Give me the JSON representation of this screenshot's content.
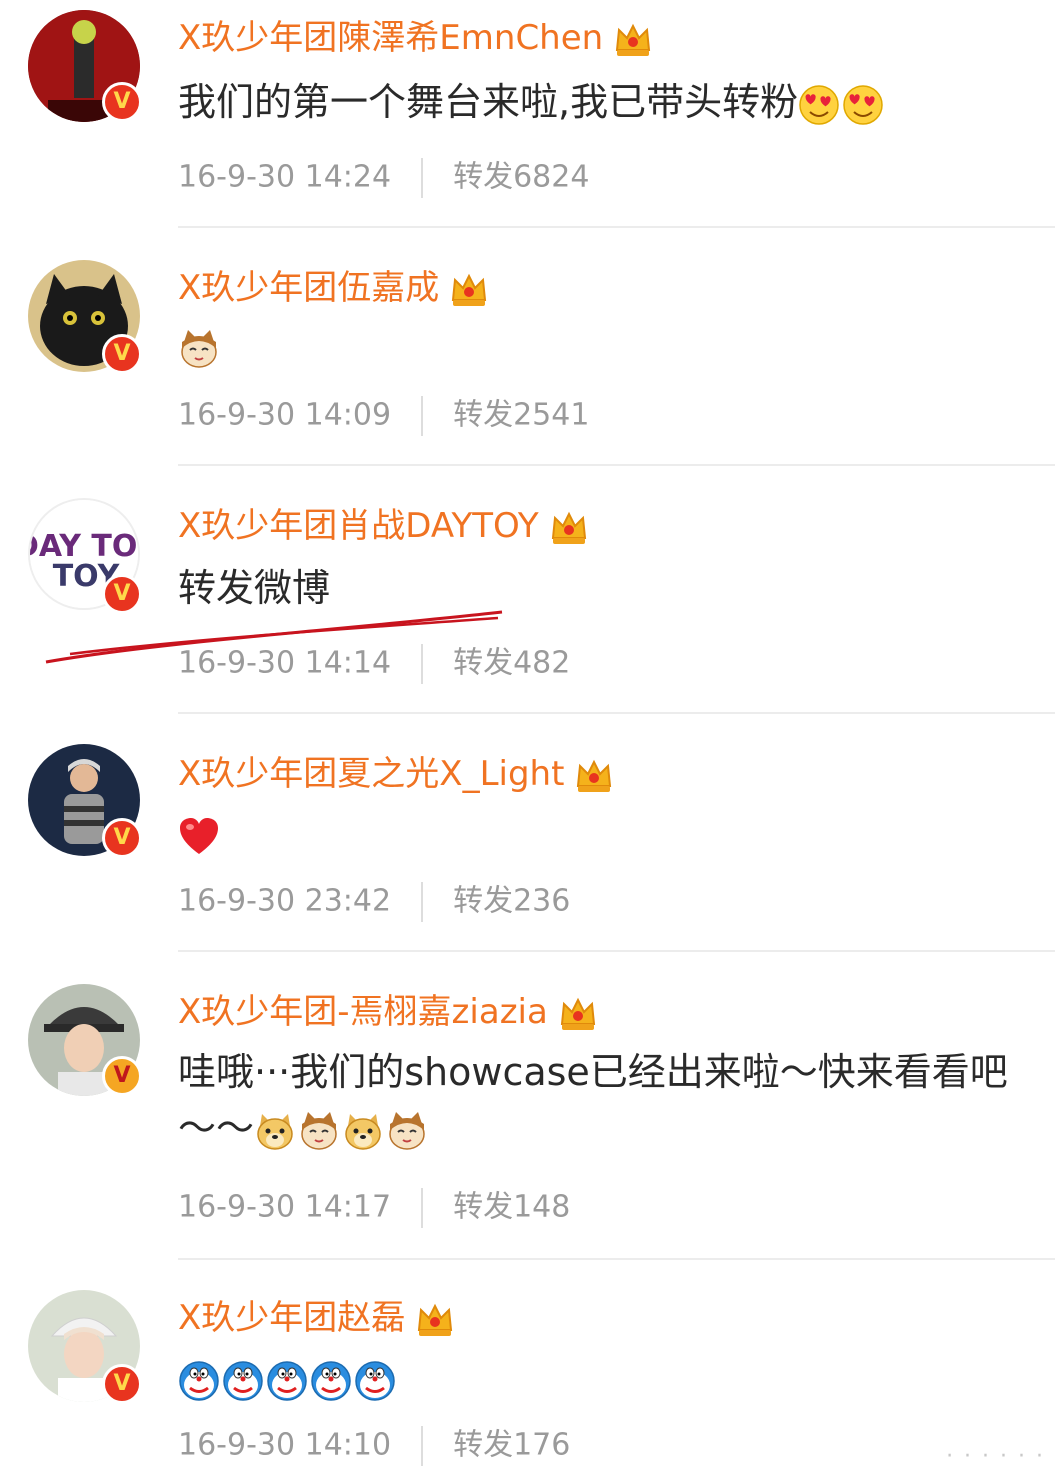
{
  "comments": [
    {
      "name": "X玖少年团陳澤希EmnChen",
      "text": "我们的第一个舞台来啦,我已带头转粉",
      "date": "16-9-30 14:24",
      "repost": "转发6824",
      "avatar": "dark-red-figure",
      "emojis": [
        "heart-eyes-emoji",
        "heart-eyes-emoji"
      ]
    },
    {
      "name": "X玖少年团伍嘉成",
      "text": "",
      "date": "16-9-30 14:09",
      "repost": "转发2541",
      "avatar": "black-cat",
      "emojis": [
        "cat-face-emoji"
      ]
    },
    {
      "name": "X玖少年团肖战DAYTOY",
      "text": "转发微博",
      "date": "16-9-30 14:14",
      "repost": "转发482",
      "avatar": "daytoy-logo",
      "avatar_text": "DAY TOY",
      "emojis": []
    },
    {
      "name": "X玖少年团夏之光X_Light",
      "text": "",
      "date": "16-9-30 23:42",
      "repost": "转发236",
      "avatar": "person-dark-bg",
      "emojis": [
        "red-heart-emoji"
      ]
    },
    {
      "name": "X玖少年团-焉栩嘉ziazia",
      "text": "哇哦···我们的showcase已经出来啦～快来看看吧～～",
      "date": "16-9-30 14:17",
      "repost": "转发148",
      "avatar": "person-hat",
      "emojis": [
        "doge-emoji",
        "cat-face-emoji",
        "doge-emoji",
        "cat-face-emoji"
      ]
    },
    {
      "name": "X玖少年团赵磊",
      "text": "",
      "date": "16-9-30 14:10",
      "repost": "转发176",
      "avatar": "person-light",
      "emojis": [
        "doraemon-emoji",
        "doraemon-emoji",
        "doraemon-emoji",
        "doraemon-emoji",
        "doraemon-emoji"
      ]
    }
  ],
  "watermark": "· · · · · ·",
  "colors": {
    "name": "#f07322",
    "meta": "#9a9a9a",
    "underline": "#c8141e",
    "verified": "#f5a623"
  }
}
